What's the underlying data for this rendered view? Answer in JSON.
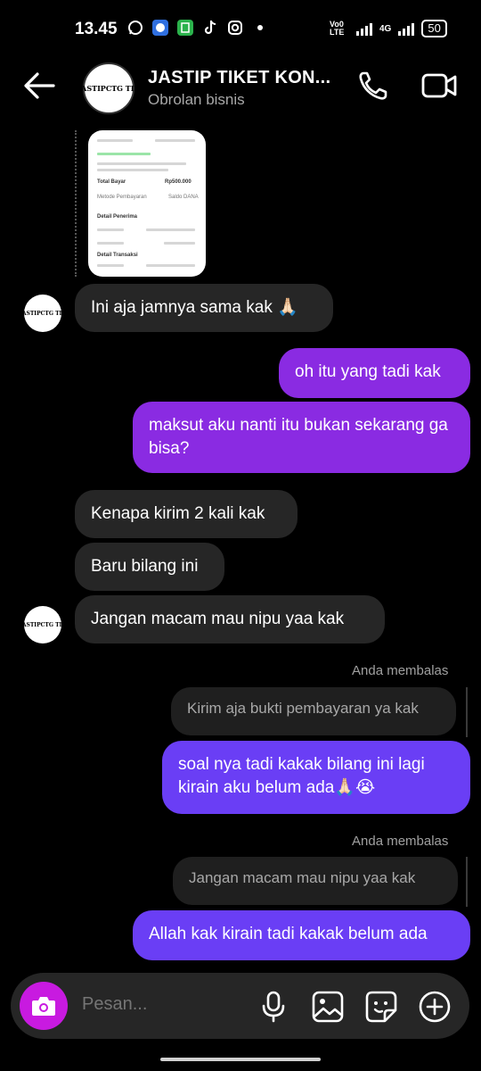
{
  "status_bar": {
    "time": "13.45",
    "carrier": "Vo0 LTE",
    "network": "4G",
    "battery": "50",
    "icons": [
      "whatsapp-icon",
      "browser-icon",
      "app-icon",
      "tiktok-icon",
      "instagram-icon",
      "dot-icon"
    ]
  },
  "header": {
    "title": "JASTIP TIKET KON...",
    "subtitle": "Obrolan bisnis",
    "avatar_text": "JASTIPCTG TIX"
  },
  "image_message": {
    "lines": [
      "Total Bayar",
      "Rp500.000",
      "Metode Pembayaran",
      "Saldo DANA",
      "Detail Penerima",
      "Detail Transaksi"
    ]
  },
  "messages": [
    {
      "side": "in",
      "text": "Ini aja jamnya sama kak 🙏🏻"
    },
    {
      "side": "out",
      "text": "oh itu yang tadi kak"
    },
    {
      "side": "out",
      "text": "maksut aku nanti itu bukan sekarang ga bisa?"
    },
    {
      "side": "in",
      "text": "Kenapa kirim 2 kali kak"
    },
    {
      "side": "in",
      "text": "Baru bilang ini"
    },
    {
      "side": "in",
      "text": "Jangan macam mau nipu yaa kak"
    }
  ],
  "replies": [
    {
      "label": "Anda membalas",
      "quoted": "Kirim aja bukti pembayaran ya kak",
      "text": "soal nya tadi kakak bilang ini lagi kirain aku belum ada🙏🏻😭"
    },
    {
      "label": "Anda membalas",
      "quoted": "Jangan macam mau nipu yaa kak",
      "text": "Allah kak kirain tadi kakak belum ada"
    }
  ],
  "composer": {
    "placeholder": "Pesan..."
  },
  "colors": {
    "outgoing_bubble": "#8a2be2",
    "outgoing_bubble_blue": "#6a3ef5",
    "incoming_bubble": "#262626",
    "camera_button": "#c81ae0"
  }
}
